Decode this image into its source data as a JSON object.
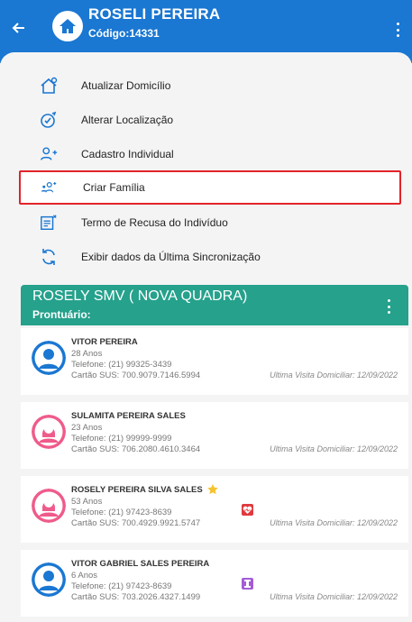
{
  "header": {
    "name": "ROSELI PEREIRA",
    "code": "Código:14331"
  },
  "menu": [
    {
      "label": "Atualizar Domicílio"
    },
    {
      "label": "Alterar Localização"
    },
    {
      "label": "Cadastro Individual"
    },
    {
      "label": "Criar Família"
    },
    {
      "label": "Termo de Recusa do Indivíduo"
    },
    {
      "label": "Exibir dados da Última Sincronização"
    }
  ],
  "family": {
    "title": "ROSELY SMV ( NOVA QUADRA)",
    "prontuario": "Prontuário:"
  },
  "members": [
    {
      "name": "VITOR PEREIRA",
      "age": "28 Anos",
      "phone": "Telefone: (21) 99325-3439",
      "sus": "Cartão SUS: 700.9079.7146.5994",
      "visit": "Ultima Visita Domiciliar: 12/09/2022"
    },
    {
      "name": "SULAMITA PEREIRA SALES",
      "age": "23 Anos",
      "phone": "Telefone: (21) 99999-9999",
      "sus": "Cartão SUS: 706.2080.4610.3464",
      "visit": "Ultima Visita Domiciliar: 12/09/2022"
    },
    {
      "name": "ROSELY PEREIRA SILVA SALES",
      "age": "53 Anos",
      "phone": "Telefone: (21) 97423-8639",
      "sus": "Cartão SUS: 700.4929.9921.5747",
      "visit": "Ultima Visita Domiciliar: 12/09/2022"
    },
    {
      "name": "VITOR GABRIEL SALES PEREIRA",
      "age": "6 Anos",
      "phone": "Telefone: (21) 97423-8639",
      "sus": "Cartão SUS: 703.2026.4327.1499",
      "visit": "Ultima Visita Domiciliar: 12/09/2022"
    }
  ],
  "colors": {
    "header": "#1a77d2",
    "family_bar": "#25a18c",
    "male_avatar": "#1a77d2",
    "female_avatar": "#ef5b8a",
    "highlight": "#e22329"
  }
}
